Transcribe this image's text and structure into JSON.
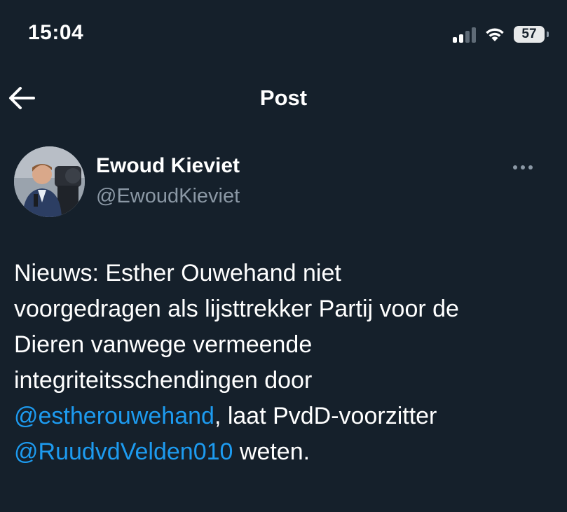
{
  "status_bar": {
    "time": "15:04",
    "battery_level": "57",
    "icons": [
      "cellular-signal-icon",
      "wifi-icon",
      "battery-icon"
    ]
  },
  "header": {
    "title": "Post",
    "back_icon": "arrow-left-icon"
  },
  "post": {
    "author_name": "Ewoud Kieviet",
    "author_handle": "@EwoudKieviet",
    "more_icon": "more-horizontal-icon",
    "text_segments": {
      "line1": "Nieuws: Esther Ouwehand niet",
      "line2": "voorgedragen als lijsttrekker Partij voor de",
      "line3": "Dieren vanwege vermeende",
      "line4": "integriteitsschendingen door",
      "mention1": "@estherouwehand",
      "after_mention1": ", laat PvdD-voorzitter",
      "mention2": "@RuudvdVelden010",
      "after_mention2": " weten."
    }
  },
  "colors": {
    "background": "#15202b",
    "text_primary": "#ffffff",
    "text_secondary": "#8b98a5",
    "link": "#1d9bf0"
  }
}
